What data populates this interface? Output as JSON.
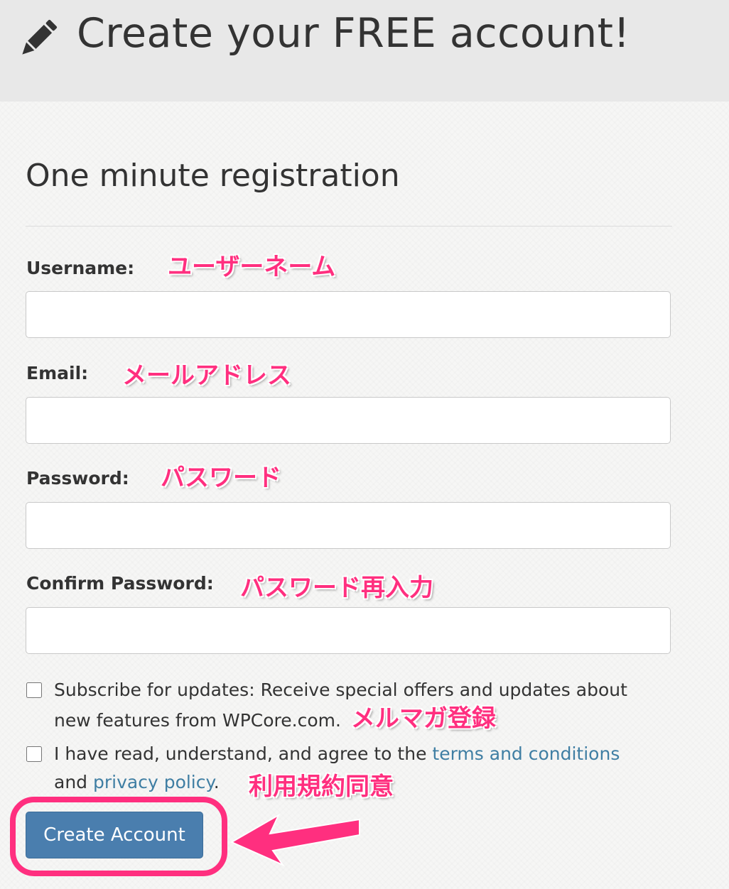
{
  "header": {
    "icon": "pencil-icon",
    "title": "Create your FREE account!"
  },
  "form": {
    "title": "One minute registration",
    "fields": {
      "username": {
        "label": "Username:",
        "value": "",
        "annotation": "ユーザーネーム"
      },
      "email": {
        "label": "Email:",
        "value": "",
        "annotation": "メールアドレス"
      },
      "password": {
        "label": "Password:",
        "value": "",
        "annotation": "パスワード"
      },
      "confirm_password": {
        "label": "Confirm Password:",
        "value": "",
        "annotation": "パスワード再入力"
      }
    },
    "subscribe": {
      "checked": false,
      "text": "Subscribe for updates: Receive special offers and updates about new features from WPCore.com.",
      "annotation": "メルマガ登録"
    },
    "terms": {
      "checked": false,
      "text_before": "I have read, understand, and agree to the",
      "terms_link": "terms and conditions",
      "text_and": "and",
      "privacy_link": "privacy policy",
      "text_end": ".",
      "annotation": "利用規約同意"
    },
    "submit_label": "Create Account"
  },
  "colors": {
    "annotation": "#ff2f7f",
    "button": "#4a7eae",
    "link": "#3f7ea3",
    "header_bg": "#e8e8e8"
  }
}
